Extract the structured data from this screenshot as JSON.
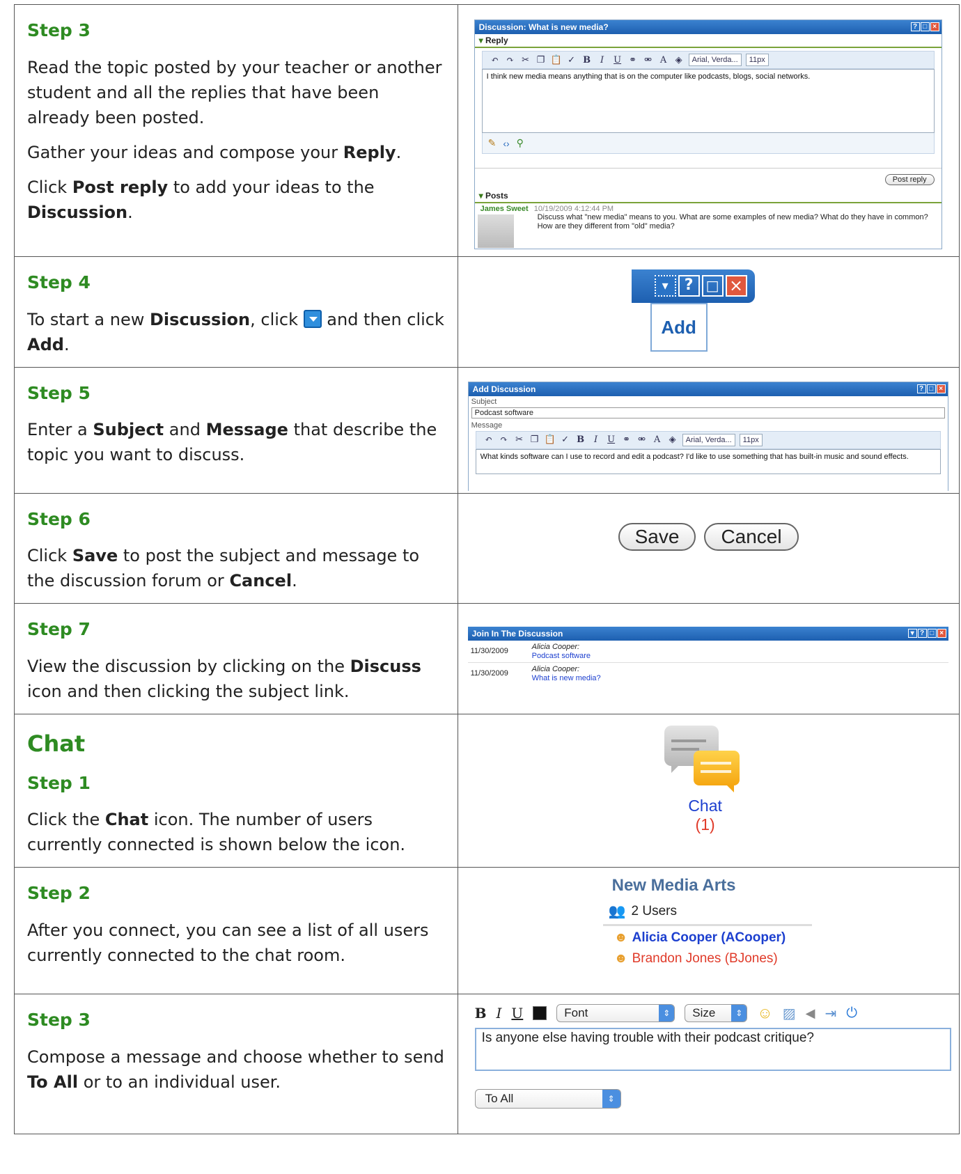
{
  "rows": [
    {
      "heading": "Step 3",
      "p1": "Read the topic posted by your teacher or another student and all the replies that have been already been posted.",
      "p2_pre": "Gather your ideas and compose your ",
      "p2_bold": "Reply",
      "p2_post": ".",
      "p3_a": "Click ",
      "p3_b": "Post reply",
      "p3_c": " to add your ideas to the ",
      "p3_d": "Discussion",
      "p3_e": "."
    },
    {
      "heading": "Step 4",
      "p_a": "To start a new ",
      "p_b": "Discussion",
      "p_c": ", click ",
      "p_d": " and then click ",
      "p_e": "Add",
      "p_f": "."
    },
    {
      "heading": "Step 5",
      "p_a": "Enter a ",
      "p_b": "Subject",
      "p_c": " and ",
      "p_d": "Message",
      "p_e": " that describe the topic you want to discuss."
    },
    {
      "heading": "Step 6",
      "p_a": "Click ",
      "p_b": "Save",
      "p_c": " to post the subject and message to the discussion forum or ",
      "p_d": "Cancel",
      "p_e": "."
    },
    {
      "heading": "Step 7",
      "p_a": "View the discussion by clicking on the ",
      "p_b": "Discuss",
      "p_c": " icon and then clicking the subject link."
    },
    {
      "section": "Chat",
      "heading": "Step 1",
      "p_a": "Click the ",
      "p_b": "Chat",
      "p_c": " icon. The number of users currently connected is shown below the icon."
    },
    {
      "heading": "Step 2",
      "p1": "After you connect, you can see a list of all users currently connected to the chat room."
    },
    {
      "heading": "Step 3",
      "p_a": "Compose a message and choose whether to send ",
      "p_b": "To All",
      "p_c": " or to an individual user."
    }
  ],
  "shots": {
    "discussion": {
      "title": "Discussion: What is new media?",
      "reply_section": "Reply",
      "font_select": "Arial, Verda...",
      "size_select": "11px",
      "editor_text": "I think new media means anything that is on the computer like podcasts, blogs, social networks.",
      "post_reply": "Post reply",
      "posts_section": "Posts",
      "post_author": "James Sweet",
      "post_date": "10/19/2009 4:12:44 PM",
      "post_text": "Discuss what \"new media\" means to you. What are some examples of new media? What do they have in common? How are they different from \"old\" media?"
    },
    "add_menu": {
      "add_label": "Add"
    },
    "add_discussion": {
      "title": "Add Discussion",
      "subject_label": "Subject",
      "subject_value": "Podcast software",
      "message_label": "Message",
      "font_select": "Arial, Verda...",
      "size_select": "11px",
      "message_text": "What kinds software can I use to record and edit a podcast? I'd like to use something that has built-in music and sound effects."
    },
    "buttons": {
      "save": "Save",
      "cancel": "Cancel"
    },
    "join": {
      "title": "Join In The Discussion",
      "items": [
        {
          "date": "11/30/2009",
          "author": "Alicia Cooper:",
          "subject": "Podcast software"
        },
        {
          "date": "11/30/2009",
          "author": "Alicia Cooper:",
          "subject": "What is new media?"
        }
      ]
    },
    "chat_icon": {
      "label": "Chat",
      "count": "(1)"
    },
    "chat_room": {
      "title": "New Media Arts",
      "users_count": "2 Users",
      "users": [
        {
          "name": "Alicia Cooper (ACooper)",
          "color": "#1c3fcf"
        },
        {
          "name": "Brandon Jones (BJones)",
          "color": "#e03b2a"
        }
      ]
    },
    "compose": {
      "font_select": "Font",
      "size_select": "Size",
      "message": "Is anyone else having trouble with their podcast critique?",
      "to_select": "To All"
    }
  },
  "colors": {
    "step_heading": "#2e8b22",
    "link": "#1c3fcf"
  }
}
